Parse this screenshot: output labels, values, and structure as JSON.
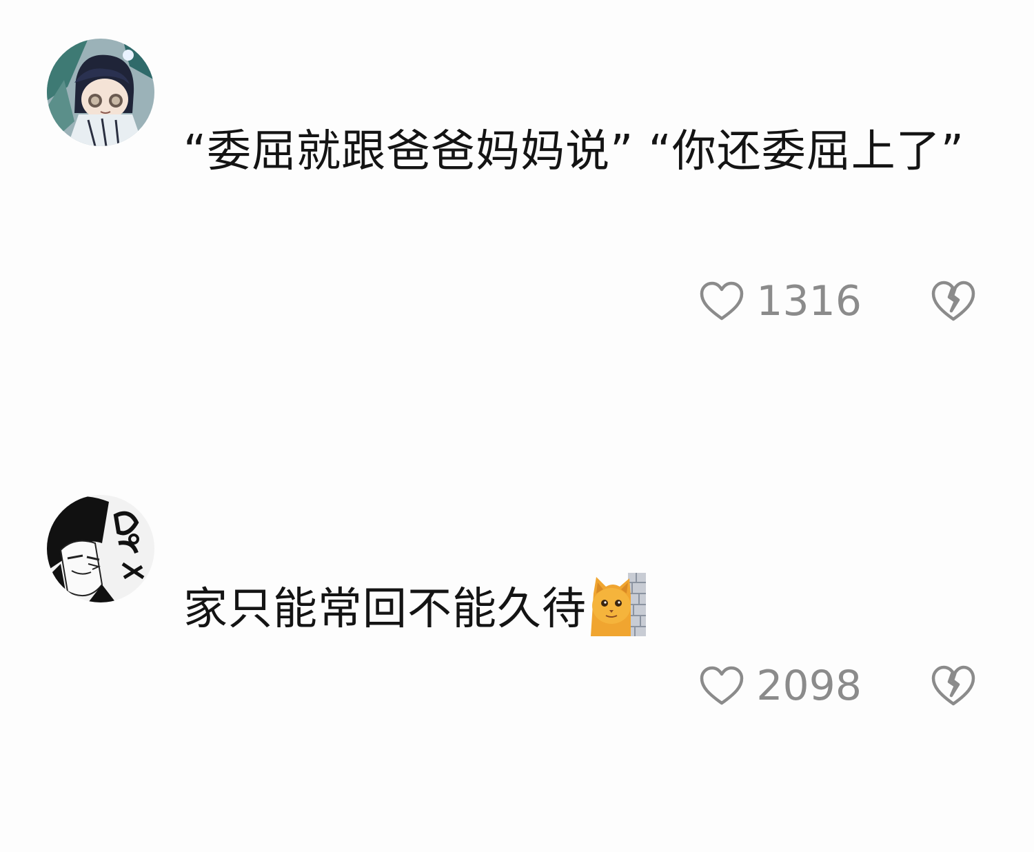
{
  "comments": [
    {
      "text": "“委屈就跟爸爸妈妈说” “你还委屈上了”",
      "likes": "1316",
      "avatar_icon": "anime-avatar-icon",
      "emoji": null
    },
    {
      "text": "家只能常回不能久待",
      "likes": "2098",
      "avatar_icon": "manga-avatar-icon",
      "emoji": "cat-peeking-wall-emoji"
    }
  ],
  "colors": {
    "text": "#141414",
    "count": "#8b8b8b",
    "icon": "#8b8b8b",
    "background": "#fdfdfd"
  }
}
